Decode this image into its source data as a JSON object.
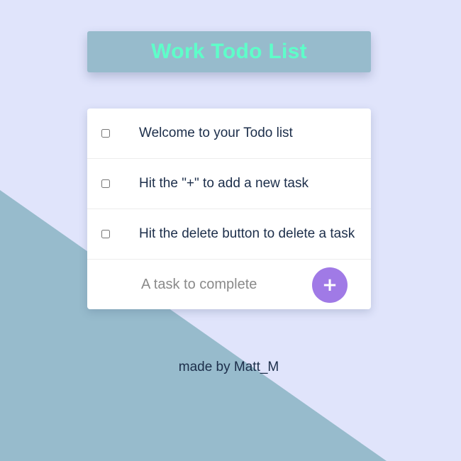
{
  "colors": {
    "background": "#e0e4fb",
    "accent_triangle": "#97bbcc",
    "title_text": "#5effc9",
    "add_button": "#a07ae6",
    "task_text": "#1c2e4a"
  },
  "header": {
    "title": "Work Todo List"
  },
  "tasks": [
    {
      "label": "Welcome to your Todo list",
      "checked": false
    },
    {
      "label": "Hit the \"+\" to add a new task",
      "checked": false
    },
    {
      "label": "Hit the delete button to delete a task",
      "checked": false
    }
  ],
  "new_task": {
    "placeholder": "A task to complete",
    "value": "",
    "add_label": "+"
  },
  "footer": {
    "credit": "made by Matt_M"
  }
}
